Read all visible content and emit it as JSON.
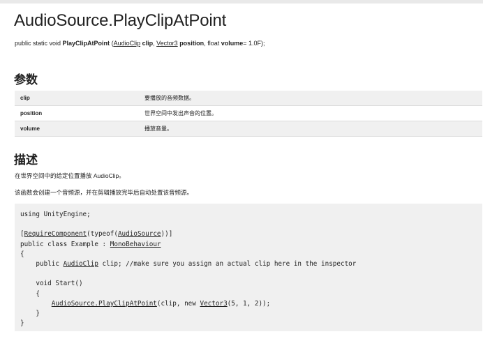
{
  "title": "AudioSource.PlayClipAtPoint",
  "signature": {
    "prefix": "public static void ",
    "method": "PlayClipAtPoint",
    "open_paren": " (",
    "type1": "AudioClip",
    "param1": "clip",
    "sep1": ", ",
    "type2": "Vector3",
    "param2": "position",
    "sep2": ", float ",
    "param3": "volume",
    "default": "= 1.0F);"
  },
  "params_heading": "参数",
  "params": [
    {
      "name": "clip",
      "desc": "要播放的音频数据。"
    },
    {
      "name": "position",
      "desc": "世界空间中发出声音的位置。"
    },
    {
      "name": "volume",
      "desc": "播放音量。"
    }
  ],
  "desc_heading": "描述",
  "desc1": "在世界空间中的给定位置播放 AudioClip。",
  "desc2": "该函数会创建一个音频源，并在剪辑播放完毕后自动处置该音频源。",
  "code": {
    "l1": "using UnityEngine;",
    "l3_open": "[",
    "l3_link1": "RequireComponent",
    "l3_mid": "(typeof(",
    "l3_link2": "AudioSource",
    "l3_close": "))]",
    "l4_text": "public class Example : ",
    "l4_link": "MonoBehaviour",
    "l5": "{",
    "l6_pre": "    public ",
    "l6_link": "AudioClip",
    "l6_post": " clip; //make sure you assign an actual clip here in the inspector",
    "l8": "    void Start()",
    "l9": "    {",
    "l10_indent": "        ",
    "l10_link": "AudioSource.PlayClipAtPoint",
    "l10_mid": "(clip, new ",
    "l10_link2": "Vector3",
    "l10_post": "(5, 1, 2));",
    "l11": "    }",
    "l12": "}"
  }
}
